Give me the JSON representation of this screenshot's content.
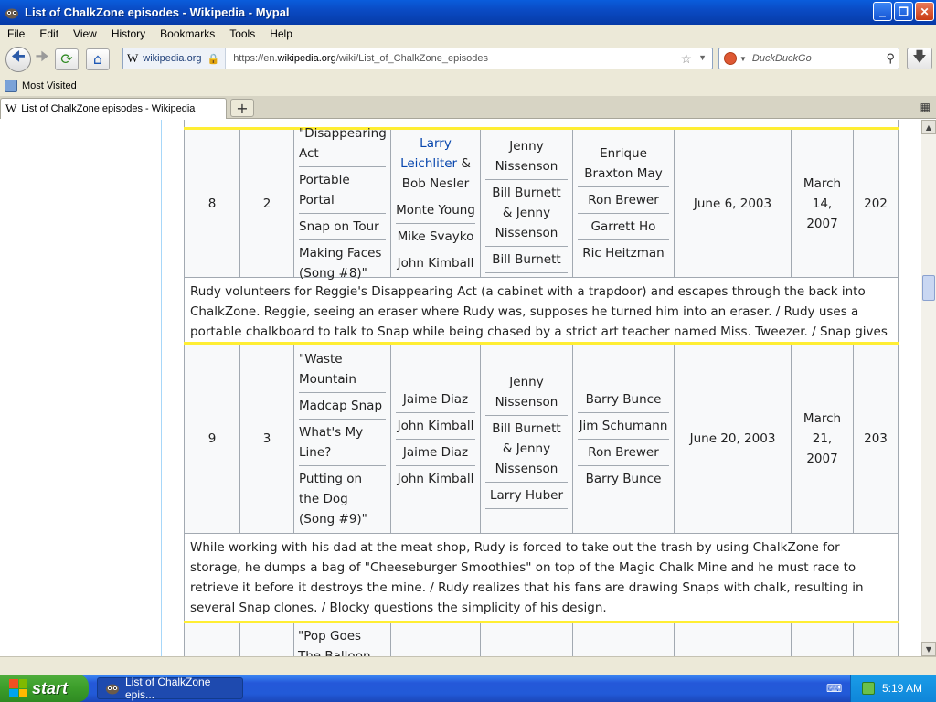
{
  "window": {
    "title": "List of ChalkZone episodes - Wikipedia - Mypal",
    "controls": [
      "_",
      "❐",
      "✕"
    ]
  },
  "menu": [
    "File",
    "Edit",
    "View",
    "History",
    "Bookmarks",
    "Tools",
    "Help"
  ],
  "nav": {
    "identity": "wikipedia.org",
    "url_prefix": "https://en.",
    "url_domain": "wikipedia.org",
    "url_path": "/wiki/List_of_ChalkZone_episodes",
    "search_placeholder": "DuckDuckGo"
  },
  "bookmarks": {
    "most_visited": "Most Visited"
  },
  "tab": {
    "title": "List of ChalkZone episodes - Wikipedia"
  },
  "episodes": [
    {
      "overall": "8",
      "season": "2",
      "titles": [
        "\"Disappearing Act",
        "Portable Portal",
        "Snap on Tour",
        "Making Faces (Song #8)\""
      ],
      "directors": [
        {
          "parts": [
            {
              "text": "Larry Leichliter",
              "link": true
            },
            {
              "text": " & Bob Nesler",
              "link": false
            }
          ]
        },
        {
          "parts": [
            {
              "text": "Monte Young",
              "link": false
            }
          ]
        },
        {
          "parts": [
            {
              "text": "Mike Svayko",
              "link": false
            }
          ]
        },
        {
          "parts": [
            {
              "text": "John Kimball",
              "link": false
            }
          ]
        }
      ],
      "writers": [
        "Jenny Nissenson",
        "Bill Burnett & Jenny Nissenson",
        "Bill Burnett"
      ],
      "storyboard": [
        "Enrique Braxton May",
        "Ron Brewer",
        "Garrett Ho",
        "Ric Heitzman"
      ],
      "air_date": "June 6, 2003",
      "uk_date": "March 14, 2007",
      "prod": "202",
      "summary": "Rudy volunteers for Reggie's Disappearing Act (a cabinet with a trapdoor) and escapes through the back into ChalkZone. Reggie, seeing an eraser where Rudy was, supposes he turned him into an eraser. / Rudy uses a portable chalkboard to talk to Snap while being chased by a strict art teacher named Miss. Tweezer. / Snap gives a tour of ChalkZone."
    },
    {
      "overall": "9",
      "season": "3",
      "titles": [
        "\"Waste Mountain",
        "Madcap Snap",
        "What's My Line?",
        "Putting on the Dog (Song #9)\""
      ],
      "directors": [
        {
          "parts": [
            {
              "text": "Jaime Diaz",
              "link": false
            }
          ]
        },
        {
          "parts": [
            {
              "text": "John Kimball",
              "link": false
            }
          ]
        },
        {
          "parts": [
            {
              "text": "Jaime Diaz",
              "link": false
            }
          ]
        },
        {
          "parts": [
            {
              "text": "John Kimball",
              "link": false
            }
          ]
        }
      ],
      "writers": [
        "Jenny Nissenson",
        "Bill Burnett & Jenny Nissenson",
        "Larry Huber"
      ],
      "storyboard": [
        "Barry Bunce",
        "Jim Schumann",
        "Ron Brewer",
        "Barry Bunce"
      ],
      "air_date": "June 20, 2003",
      "uk_date": "March 21, 2007",
      "prod": "203",
      "summary": "While working with his dad at the meat shop, Rudy is forced to take out the trash by using ChalkZone for storage, he dumps a bag of \"Cheeseburger Smoothies\" on top of the Magic Chalk Mine and he must race to retrieve it before it destroys the mine. / Rudy realizes that his fans are drawing Snaps with chalk, resulting in several Snap clones. / Blocky questions the simplicity of his design."
    }
  ],
  "next_title": "\"Pop Goes The Balloon",
  "taskbar": {
    "start": "start",
    "item": "List of ChalkZone epis...",
    "time": "5:19 AM"
  }
}
